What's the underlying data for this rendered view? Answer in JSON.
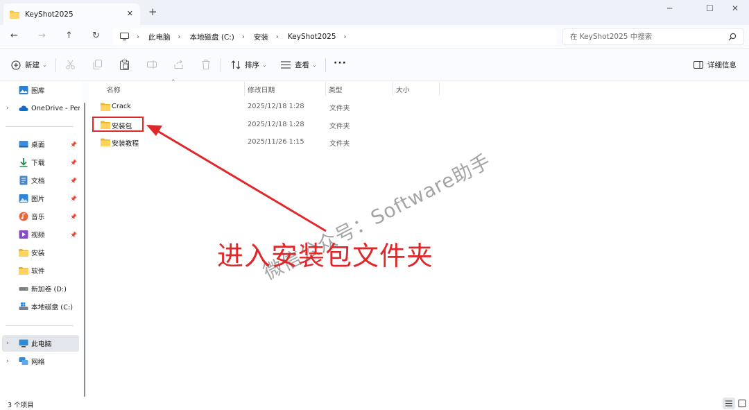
{
  "tab": {
    "title": "KeyShot2025",
    "close": "✕",
    "new": "+"
  },
  "window_controls": {
    "minimize": "─",
    "maximize": "☐",
    "close": "✕"
  },
  "address": {
    "crumbs": [
      "此电脑",
      "本地磁盘 (C:)",
      "安装",
      "KeyShot2025"
    ],
    "separator": "›"
  },
  "search": {
    "placeholder": "在 KeyShot2025 中搜索"
  },
  "toolbar": {
    "new_label": "新建",
    "sort_label": "排序",
    "view_label": "查看",
    "more_label": "···",
    "details_label": "详细信息"
  },
  "sidebar": {
    "items": [
      {
        "label": "图库",
        "icon": "gallery-icon"
      },
      {
        "label": "OneDrive - Per",
        "icon": "onedrive-icon"
      },
      {
        "label": "桌面",
        "icon": "desktop-icon",
        "pinned": true
      },
      {
        "label": "下载",
        "icon": "download-icon",
        "pinned": true
      },
      {
        "label": "文档",
        "icon": "document-icon",
        "pinned": true
      },
      {
        "label": "图片",
        "icon": "pictures-icon",
        "pinned": true
      },
      {
        "label": "音乐",
        "icon": "music-icon",
        "pinned": true
      },
      {
        "label": "视频",
        "icon": "video-icon",
        "pinned": true
      },
      {
        "label": "安装",
        "icon": "folder-icon"
      },
      {
        "label": "软件",
        "icon": "folder-icon"
      },
      {
        "label": "新加卷 (D:)",
        "icon": "drive-icon"
      },
      {
        "label": "本地磁盘 (C:)",
        "icon": "windows-drive-icon"
      },
      {
        "label": "此电脑",
        "icon": "computer-icon",
        "selected": true
      },
      {
        "label": "网络",
        "icon": "network-icon"
      }
    ]
  },
  "columns": {
    "name": "名称",
    "date": "修改日期",
    "type": "类型",
    "size": "大小"
  },
  "files": [
    {
      "name": "Crack",
      "date": "2025/12/18 1:28",
      "type": "文件夹"
    },
    {
      "name": "安装包",
      "date": "2025/12/18 1:28",
      "type": "文件夹"
    },
    {
      "name": "安装教程",
      "date": "2025/11/26 1:15",
      "type": "文件夹"
    }
  ],
  "annotation": {
    "text": "进入安装包文件夹",
    "color": "#e0282a"
  },
  "watermark": {
    "text": "微信公众号：Software助手"
  },
  "status": {
    "item_count": "3 个项目"
  },
  "colors": {
    "folder": "#f6c443",
    "accent": "#0067c0",
    "annotation_red": "#e0282a"
  }
}
